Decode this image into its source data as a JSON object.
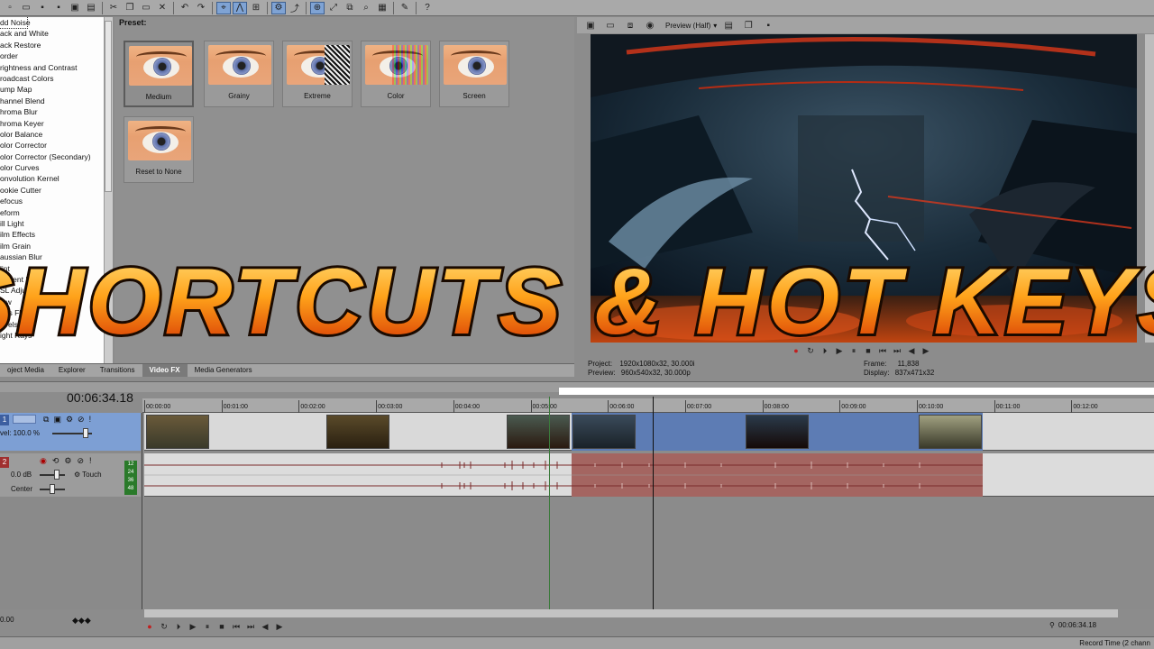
{
  "toolbar": {
    "icons": [
      "new-file-icon",
      "open-icon",
      "save-icon",
      "save-as-icon",
      "render-icon",
      "properties-icon",
      "cut-icon",
      "copy-icon",
      "paste-icon",
      "delete-icon",
      "undo-icon",
      "redo-icon",
      "normal-edit-tool-icon",
      "envelope-tool-icon",
      "selection-tool-icon",
      "auto-ripple-icon",
      "lock-envelopes-icon",
      "snapping-icon",
      "auto-crossfade-icon",
      "ignore-grouping-icon",
      "marker-icon",
      "help-icon"
    ]
  },
  "fx_list": {
    "items": [
      "dd Noise",
      "ack and White",
      "ack Restore",
      "order",
      "rightness and Contrast",
      "roadcast Colors",
      "ump Map",
      "hannel Blend",
      "hroma Blur",
      "hroma Keyer",
      "olor Balance",
      "olor Corrector",
      "olor Corrector (Secondary)",
      "olor Curves",
      "onvolution Kernel",
      "ookie Cutter",
      "efocus",
      "eform",
      "ill Light",
      "ilm Effects",
      "ilm Grain",
      "aussian Blur",
      "lint",
      "radient Map",
      "SL Adjust",
      "low",
      "ens Flare",
      "evels",
      "ight Rays"
    ],
    "selected": "dd Noise"
  },
  "presets": {
    "label": "Preset:",
    "items": [
      {
        "name": "Medium",
        "selected": true
      },
      {
        "name": "Grainy",
        "selected": false
      },
      {
        "name": "Extreme",
        "selected": false
      },
      {
        "name": "Color",
        "selected": false
      },
      {
        "name": "Screen",
        "selected": false
      },
      {
        "name": "Reset to None",
        "selected": false
      }
    ]
  },
  "tabs": [
    "oject Media",
    "Explorer",
    "Transitions",
    "Video FX",
    "Media Generators"
  ],
  "active_tab": "Video FX",
  "preview": {
    "quality_label": "Preview (Half)",
    "project_label": "Project:",
    "project_value": "1920x1080x32, 30.000i",
    "preview_label": "Preview:",
    "preview_value": "960x540x32, 30.000p",
    "frame_label": "Frame:",
    "frame_value": "11,838",
    "display_label": "Display:",
    "display_value": "837x471x32"
  },
  "timeline": {
    "current_time": "00:06:34.18",
    "ruler_labels": [
      "00:00:00",
      "00:01:00",
      "00:02:00",
      "00:03:00",
      "00:04:00",
      "00:05:00",
      "00:06:00",
      "00:07:00",
      "00:08:00",
      "00:09:00",
      "00:10:00",
      "00:11:00",
      "00:12:00"
    ],
    "track1": {
      "number": "1",
      "level_label": "vel: 100.0 %"
    },
    "track2": {
      "number": "2",
      "volume": "0.0 dB",
      "pan": "Center",
      "mode": "Touch",
      "meter": [
        "12",
        "24",
        "36",
        "48"
      ]
    },
    "status_time": "00:06:34.18",
    "rate_value": "0.00",
    "record_time": "Record Time (2 chann"
  },
  "overlay": {
    "title": "SHORTCUTS & HOT KEYS"
  }
}
